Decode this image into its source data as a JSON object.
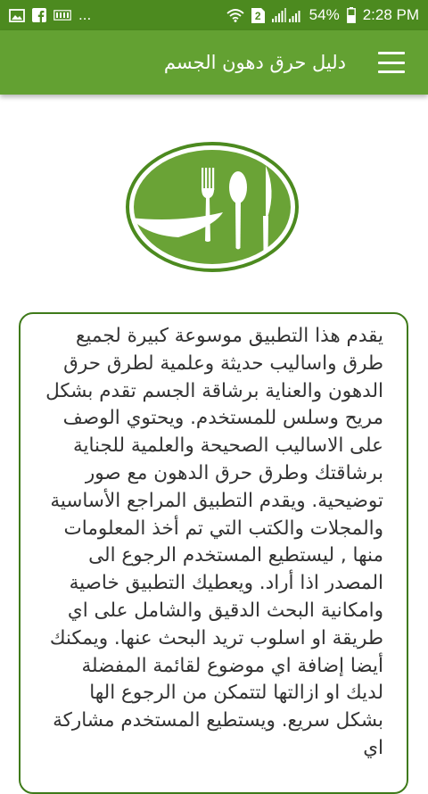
{
  "status_bar": {
    "notif_text": "...",
    "sim_label": "2",
    "battery": "54%",
    "time": "2:28 PM"
  },
  "app_bar": {
    "title": "دليل حرق دهون الجسم"
  },
  "colors": {
    "status_bar": "#4c8a1f",
    "app_bar": "#63a132",
    "logo_ring": "#6aa336",
    "card_border": "#3f7a1a"
  },
  "logo": {
    "icons": [
      "fork-icon",
      "spoon-icon",
      "knife-icon"
    ]
  },
  "description": "يقدم هذا التطبيق موسوعة كبيرة لجميع طرق واساليب حديثة وعلمية لطرق حرق الدهون والعناية برشاقة الجسم تقدم بشكل مريح وسلس للمستخدم. ويحتوي الوصف على الاساليب الصحيحة والعلمية للجناية برشاقتك وطرق حرق الدهون مع صور توضيحية. ويقدم التطبيق المراجع الأساسية والمجلات والكتب التي تم أخذ المعلومات منها , ليستطيع المستخدم الرجوع الى المصدر اذا أراد. ويعطيك التطبيق خاصية وامكانية البحث الدقيق والشامل على اي طريقة او اسلوب تريد البحث عنها. ويمكنك أيضا إضافة اي موضوع لقائمة المفضلة لديك او ازالتها لتتمكن من الرجوع الها بشكل سريع. ويستطيع المستخدم مشاركة اي"
}
